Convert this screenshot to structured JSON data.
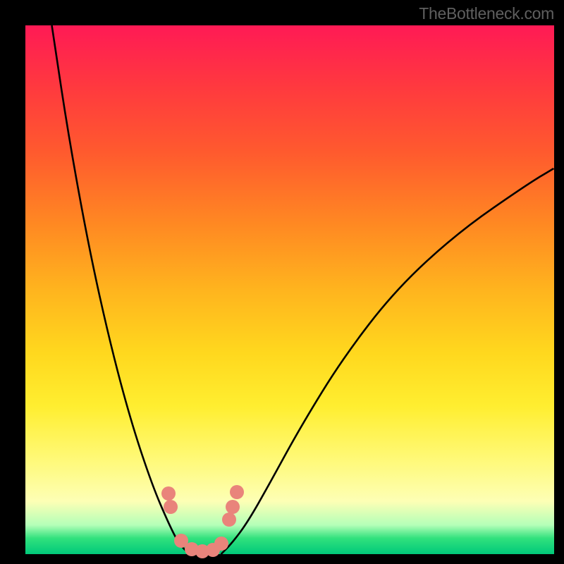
{
  "watermark": "TheBottleneck.com",
  "chart_data": {
    "type": "line",
    "title": "",
    "xlabel": "",
    "ylabel": "",
    "xlim": [
      0,
      100
    ],
    "ylim": [
      0,
      100
    ],
    "grid": false,
    "legend": false,
    "background_gradient": {
      "stops": [
        {
          "pos": 0,
          "color": "#ff1a55"
        },
        {
          "pos": 50,
          "color": "#ffd81e"
        },
        {
          "pos": 90,
          "color": "#fdffb5"
        },
        {
          "pos": 100,
          "color": "#00c97a"
        }
      ]
    },
    "series": [
      {
        "name": "left-curve",
        "x": [
          5,
          8,
          12,
          16,
          20,
          24,
          27,
          29,
          31
        ],
        "y": [
          100,
          80,
          58,
          40,
          25,
          13,
          6,
          2,
          0
        ]
      },
      {
        "name": "right-curve",
        "x": [
          37,
          39,
          42,
          46,
          52,
          60,
          70,
          82,
          95,
          100
        ],
        "y": [
          0,
          2,
          6,
          13,
          24,
          37,
          50,
          61,
          70,
          73
        ]
      }
    ],
    "markers": {
      "name": "trough-dots",
      "color": "#e9847b",
      "points": [
        {
          "x": 27.0,
          "y": 11.5
        },
        {
          "x": 27.5,
          "y": 9.0
        },
        {
          "x": 29.5,
          "y": 2.5
        },
        {
          "x": 31.5,
          "y": 1.0
        },
        {
          "x": 33.5,
          "y": 0.5
        },
        {
          "x": 35.5,
          "y": 0.8
        },
        {
          "x": 37.0,
          "y": 2.0
        },
        {
          "x": 38.5,
          "y": 6.5
        },
        {
          "x": 39.2,
          "y": 9.0
        },
        {
          "x": 40.0,
          "y": 11.8
        }
      ]
    }
  }
}
